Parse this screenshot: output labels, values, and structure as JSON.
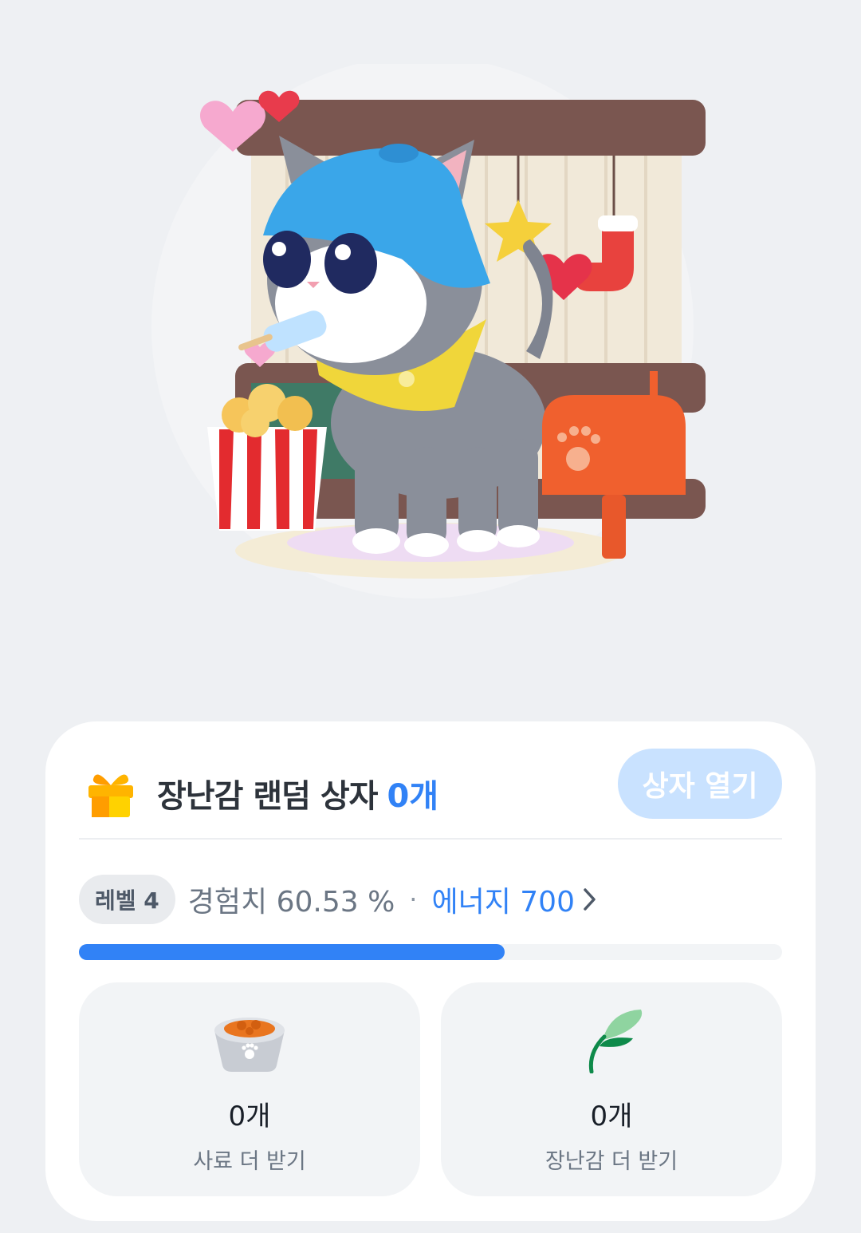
{
  "scene": {
    "image_name": "cat-with-decorations-illustration"
  },
  "box": {
    "title": "장난감 랜덤 상자",
    "count": "0개",
    "open_button": "상자 열기",
    "icon": "gift-box-icon"
  },
  "progress": {
    "level_label": "레벨 4",
    "exp_text": "경험치 60.53 %",
    "separator": "·",
    "energy_text": "에너지 700",
    "fraction": 0.6053
  },
  "rewards": [
    {
      "icon": "pet-food-bowl-icon",
      "count": "0개",
      "label": "사료 더 받기"
    },
    {
      "icon": "feather-toy-icon",
      "count": "0개",
      "label": "장난감 더 받기"
    }
  ],
  "colors": {
    "accent": "#3182f6",
    "button_disabled": "#c9e2ff",
    "background": "#eef0f3"
  }
}
